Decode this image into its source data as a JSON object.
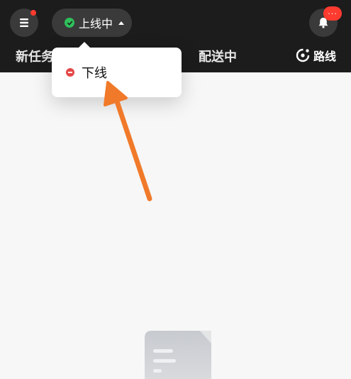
{
  "header": {
    "status_label": "上线中",
    "tabs": [
      "新任务",
      "配送中"
    ],
    "route_label": "路线",
    "notification_badge": "···"
  },
  "dropdown": {
    "items": [
      {
        "label": "下线"
      }
    ]
  },
  "colors": {
    "header_bg": "#1c1c1c",
    "online_green": "#2fbf5b",
    "offline_red": "#e54848",
    "badge_red": "#ff3b30",
    "annotation_arrow": "#f07a2a"
  }
}
